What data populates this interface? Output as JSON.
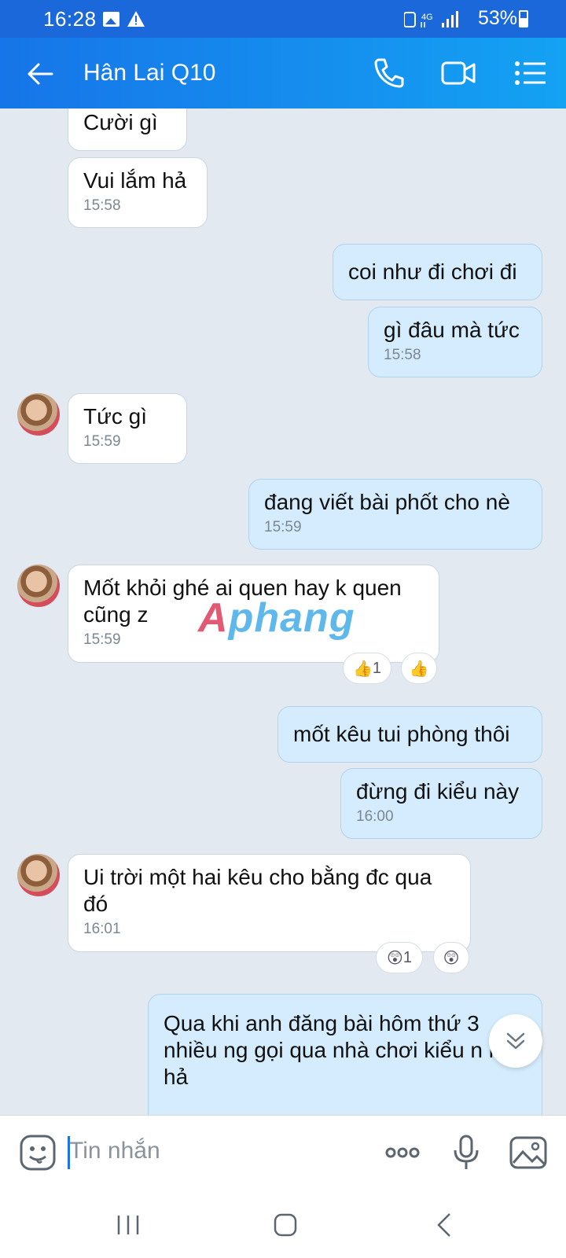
{
  "status_bar": {
    "time": "16:28",
    "network": "4G",
    "battery": "53%"
  },
  "header": {
    "title": "Hân Lai Q10"
  },
  "messages": [
    {
      "dir": "in",
      "text": "Cười gì",
      "time": ""
    },
    {
      "dir": "in",
      "text": "Vui lắm hả",
      "time": "15:58"
    },
    {
      "dir": "out",
      "text": "coi như đi chơi đi",
      "time": ""
    },
    {
      "dir": "out",
      "text": "gì đâu mà tức",
      "time": "15:58"
    },
    {
      "dir": "in",
      "text": "Tức gì",
      "time": "15:59"
    },
    {
      "dir": "out",
      "text": "đang viết bài phốt cho nè",
      "time": "15:59"
    },
    {
      "dir": "in",
      "text": "Mốt khỏi ghé ai quen hay k quen cũng z",
      "time": "15:59"
    },
    {
      "dir": "out",
      "text": "mốt kêu tui phòng thôi",
      "time": ""
    },
    {
      "dir": "out",
      "text": "đừng đi kiểu này",
      "time": "16:00"
    },
    {
      "dir": "in",
      "text": "Ui trời một hai kêu cho bằng đc qua đó",
      "time": "16:01"
    },
    {
      "dir": "out",
      "text": "Qua khi anh đăng bài hôm thứ 3 nhiều ng gọi qua nhà chơi kiểu n lắm hả",
      "time": ""
    }
  ],
  "reactions": [
    {
      "icon": "thumbs-up",
      "count": "1"
    },
    {
      "icon": "thumbs-up",
      "count": ""
    },
    {
      "icon": "shocked-face",
      "count": "1"
    },
    {
      "icon": "shocked-face",
      "count": ""
    }
  ],
  "watermark": {
    "a": "A",
    "rest": "phang"
  },
  "input": {
    "placeholder": "Tin nhắn"
  }
}
